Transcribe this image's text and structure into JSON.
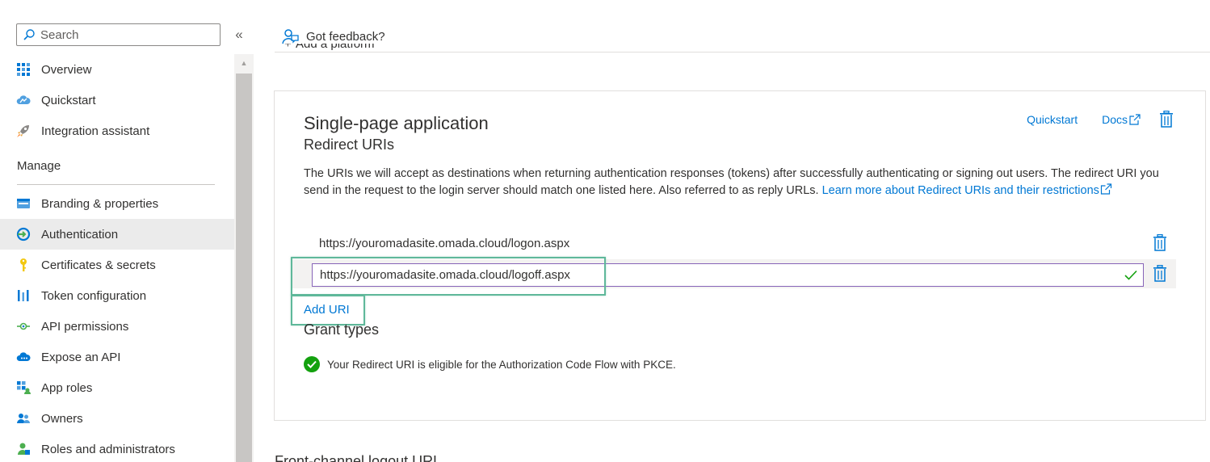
{
  "sidebar": {
    "search_placeholder": "Search",
    "collapse_glyph": "«",
    "items_top": [
      {
        "label": "Overview",
        "icon": "grid-icon"
      },
      {
        "label": "Quickstart",
        "icon": "cloud-icon"
      },
      {
        "label": "Integration assistant",
        "icon": "rocket-icon"
      }
    ],
    "section_manage": "Manage",
    "items_manage": [
      {
        "label": "Branding & properties",
        "icon": "branding-icon"
      },
      {
        "label": "Authentication",
        "icon": "authentication-icon",
        "active": true
      },
      {
        "label": "Certificates & secrets",
        "icon": "key-icon"
      },
      {
        "label": "Token configuration",
        "icon": "token-icon"
      },
      {
        "label": "API permissions",
        "icon": "api-permissions-icon"
      },
      {
        "label": "Expose an API",
        "icon": "cloud-api-icon"
      },
      {
        "label": "App roles",
        "icon": "app-roles-icon"
      },
      {
        "label": "Owners",
        "icon": "owners-icon"
      },
      {
        "label": "Roles and administrators",
        "icon": "roles-icon"
      }
    ]
  },
  "header": {
    "feedback_label": "Got feedback?",
    "clipped_add_platform": "Add a platform"
  },
  "card": {
    "title": "Single-page application",
    "subtitle": "Redirect URIs",
    "quickstart_link": "Quickstart",
    "docs_link": "Docs",
    "description": "The URIs we will accept as destinations when returning authentication responses (tokens) after successfully authenticating or signing out users. The redirect URI you send in the request to the login server should match one listed here. Also referred to as reply URLs.",
    "learn_more_link": "Learn more about Redirect URIs and their restrictions",
    "redirect_uri_1": "https://youromadasite.omada.cloud/logon.aspx",
    "redirect_uri_2": "https://youromadasite.omada.cloud/logoff.aspx",
    "add_uri_label": "Add URI",
    "grant_types_title": "Grant types",
    "grant_message": "Your Redirect URI is eligible for the Authorization Code Flow with PKCE."
  },
  "below": {
    "front_channel_title": "Front-channel logout URL"
  },
  "colors": {
    "accent": "#0078d4",
    "highlight": "#5fb89a",
    "input_border": "#8764b8",
    "success": "#13a10e"
  }
}
